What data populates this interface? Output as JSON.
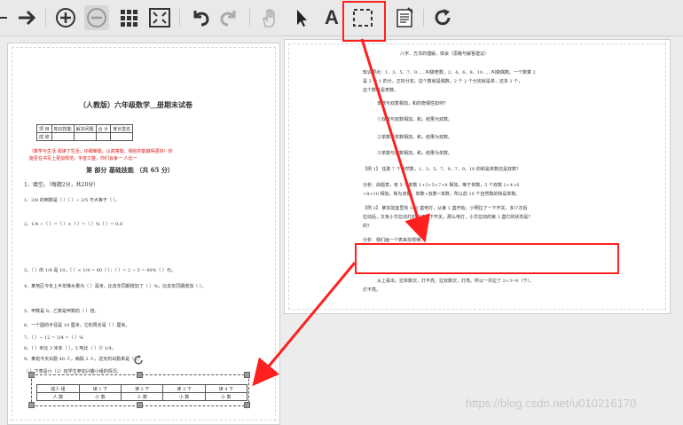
{
  "toolbar": {
    "buttons": [
      {
        "name": "next-page-icon"
      },
      {
        "name": "zoom-in-icon"
      },
      {
        "name": "zoom-out-icon"
      },
      {
        "name": "thumbnails-grid-icon"
      },
      {
        "name": "fit-page-icon"
      },
      {
        "name": "undo-icon"
      },
      {
        "name": "redo-icon"
      },
      {
        "name": "hand-tool-icon"
      },
      {
        "name": "select-arrow-icon"
      },
      {
        "name": "text-tool-icon"
      },
      {
        "name": "rect-select-icon"
      },
      {
        "name": "notes-icon"
      },
      {
        "name": "refresh-icon"
      }
    ],
    "text_tool_label": "A"
  },
  "left_page": {
    "title": "（人教版）六年级数学＿册期末试卷",
    "header_table": [
      "项 目",
      "知识技能",
      "解决问题",
      "合 计",
      "家长签名"
    ],
    "row2": "成 绩",
    "note1": "（数学与生活 阅读了生活；仔细审题，认真答题，相信你能做得更好！你",
    "note2": "能否在书写上更加规范，字迹工整，你们会争一  人比一",
    "section": "第  部分  基础技能  （共 65 分）",
    "q1": "1、填空。（每题2分，共20分）",
    "q2": "1、3/8 的倒数是（    ）（    ）÷ 2/5 不大等于（    ）。",
    "q3": "2、1/4 ÷（    ）=（    ）×（    ）=（    ）%（    ）= 0.8",
    "q4": "3、（    ）的 1/4 是 10，（    ）× 1/4 = 60（    ）：（    ）= 2 ÷ 5 = 40%（    ）元。",
    "q5": "4、某地区今年上半年降水量为（  ）毫米，比去年同期增加了（  ）%，比去年同期增加（  ）。",
    "q6": "5、甲数是 8，乙数是甲数的（    ）倍。",
    "q7": "6、一个圆的半径是 10 厘米，它的周长是（    ）厘米。",
    "q8": "7、（    ）÷ 12 = 3/4 =（    ）%",
    "q9": "8、（    ）米比 3 米多（    ），5 吨比（    ）少 1/4。",
    "q10": "9、某班今天出勤 48 人，病假 2 人，这天的出勤率是（    ）。",
    "caption": "（   ）下表是六（1）班学生参加兴趣小组的情况。",
    "bottom_table_head": [
      "成人 组",
      "读 1 下",
      "读 2 下",
      "读 3 下",
      "读 4 下"
    ],
    "bottom_table_row": [
      "人 数",
      "小 数",
      "人 数",
      "小 数",
      "小 数"
    ]
  },
  "right_page": {
    "heading": "八字、方法的理解，体会（思路与解答建议）",
    "line1": "知识要点：1、3、5、7、9……叫做奇数，2、4、6、8、10……叫做偶数。一个数乘 2",
    "line2": "是 2 个 1 的分，正好分完，这个数就是偶数。2 个 2 个分完就是单，还多 1 个，",
    "line3": "这个数就是奇数。",
    "rule1": "单数与双数相加，和的奇偶性如何？",
    "rule2": "①双数与双数相加，和，结果为双数。",
    "rule3": "②单数与单数相加，和，结果为双数。",
    "rule4": "③单数与双数相加，和，结果为单数。",
    "ex1": "【例 1】 任取 7 个自然数，1、3、5、7、9、7、9、10 的和是单数还是双数？",
    "ana1": "分析：由题意，有 5 个单数 1+3+5+7+9 相加，等于单数，5 个双数 2+4+6",
    "ana2": "+8+10 相加，和为双数，单数+双数=单数，所以前 10 个自然数的和是单数。",
    "ex2": "【例 2】 某实验室里有 100 盏电灯，从第 1 盏开始，小明拉了一下开关，多少次后",
    "ex2b": "拉动后，又有小华拉动灯的拉了一下开关，那么电灯，小华拉动的第 3 盏灯的状态是？",
    "ex2c": "的？",
    "ana3": "分析：我们画一个表来找规律。",
    "answer": "从上看出，拉单数次，灯不亮，拉双数次，灯亮。所以一共拉了 2+3=6（下），",
    "answer2": "灯不亮。"
  },
  "watermark": "https://blog.csdn.net/u010216170"
}
